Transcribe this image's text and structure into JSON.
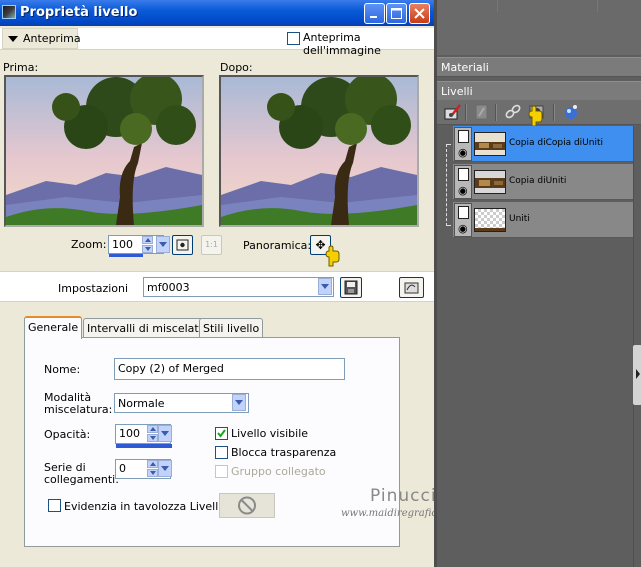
{
  "dialog": {
    "title": "Proprietà livello",
    "preview_toggle": "Anteprima",
    "image_preview_label": "Anteprima dell'immagine",
    "before_label": "Prima:",
    "after_label": "Dopo:",
    "zoom_label": "Zoom:",
    "zoom_value": "100",
    "zoom_11": "1:1",
    "pan_label": "Panoramica:",
    "settings_label": "Impostazioni",
    "settings_value": "mf0003",
    "tabs": [
      {
        "label": "Generale",
        "active": true
      },
      {
        "label": "Intervalli di miscelatura",
        "active": false
      },
      {
        "label": "Stili livello",
        "active": false
      }
    ],
    "general": {
      "name_label": "Nome:",
      "name_value": "Copy (2) of Merged",
      "blend_label_1": "Modalità",
      "blend_label_2": "miscelatura:",
      "blend_value": "Normale",
      "opacity_label": "Opacità:",
      "opacity_value": "100",
      "links_label_1": "Serie di",
      "links_label_2": "collegamenti:",
      "links_value": "0",
      "visible_label": "Livello visibile",
      "visible_checked": true,
      "lock_label": "Blocca trasparenza",
      "lock_checked": false,
      "group_label": "Gruppo collegato",
      "group_checked": false,
      "highlight_label": "Evidenzia in tavolozza Livelli:",
      "highlight_checked": false
    }
  },
  "watermark": {
    "name": "Pinuccia",
    "url": "www.maidiregrafica.eu"
  },
  "palette": {
    "materials_title": "Materiali",
    "layers_title": "Livelli",
    "layers": [
      {
        "name": "Copia diCopia diUniti",
        "selected": true,
        "thumb": "image"
      },
      {
        "name": "Copia diUniti",
        "selected": false,
        "thumb": "image"
      },
      {
        "name": "Uniti",
        "selected": false,
        "thumb": "transparent"
      }
    ]
  },
  "colors": {
    "titlebar": "#0a5bd8",
    "selected_layer": "#3e8ff0",
    "dialog_bg": "#ece9d8",
    "palette_bg": "#5e5e5e"
  }
}
